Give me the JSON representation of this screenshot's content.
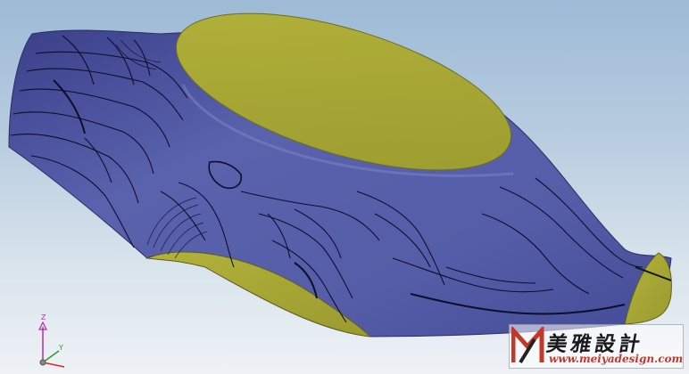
{
  "viewport": {
    "background_top": "#9dbad6",
    "background_bottom": "#eef2f6"
  },
  "model": {
    "body_color": "#565ea8",
    "face_color": "#a6a536",
    "contour_color": "#0c0f2a"
  },
  "triad": {
    "z_label": "Z",
    "y_label": "Y",
    "x_color": "#d32b2b",
    "y_color": "#2a9d2a",
    "z_color": "#b82aa8"
  },
  "watermark": {
    "title": "美雅設計",
    "url": "www.meiyadesign.com",
    "logo_icon": "M-logo-icon"
  }
}
